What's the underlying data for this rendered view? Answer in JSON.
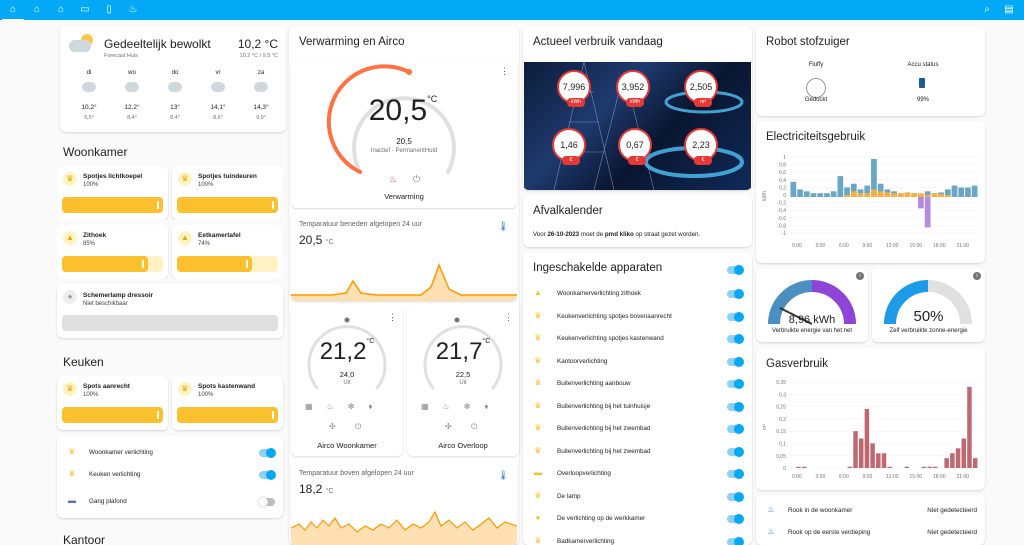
{
  "topbar": {
    "tabs": [
      "home-icon",
      "home-icon",
      "home-icon",
      "monitor-icon",
      "phone-icon",
      "fire-icon"
    ],
    "right": [
      "search-icon",
      "chat-icon"
    ]
  },
  "weather": {
    "condition": "Gedeeltelijk bewolkt",
    "location": "Forecast Huis",
    "temperature": "10,2 °C",
    "subtemp": "10,2 °C / 9,5 °C",
    "days": [
      {
        "day": "di",
        "high": "10,2°",
        "low": "9,5°"
      },
      {
        "day": "wo",
        "high": "12,2°",
        "low": "8,4°"
      },
      {
        "day": "do",
        "high": "13°",
        "low": "8,4°"
      },
      {
        "day": "vr",
        "high": "14,1°",
        "low": "8,6°"
      },
      {
        "day": "za",
        "high": "14,3°",
        "low": "9,9°"
      }
    ]
  },
  "woonkamer": {
    "title": "Woonkamer",
    "tiles": [
      {
        "name": "Spotjes lichtkoepel",
        "state": "100%",
        "level": 1.0
      },
      {
        "name": "Spotjes tuindeuren",
        "state": "100%",
        "level": 1.0
      },
      {
        "name": "Zithoek",
        "state": "85%",
        "level": 0.85
      },
      {
        "name": "Eetkamertafel",
        "state": "74%",
        "level": 0.74
      }
    ],
    "lamp": {
      "name": "Schemerlamp dressoir",
      "state": "Niet beschikbaar"
    }
  },
  "keuken": {
    "title": "Keuken",
    "tiles": [
      {
        "name": "Spots aanrecht",
        "state": "100%",
        "level": 1.0
      },
      {
        "name": "Spots kastenwand",
        "state": "100%",
        "level": 1.0
      }
    ],
    "switches": [
      {
        "label": "Woonkamer verlichting",
        "on": true
      },
      {
        "label": "Keuken verlichting",
        "on": true
      },
      {
        "label": "Gang plafond",
        "on": false
      }
    ]
  },
  "kantoor": {
    "title": "Kantoor"
  },
  "heating": {
    "title": "Verwarming en Airco",
    "main": {
      "temp": "20,5",
      "unit": "°C",
      "target": "20,5",
      "status": "Inactief - PermanentHold",
      "name": "Verwarming"
    },
    "graph1": {
      "title": "Temparatuur beneden afgelopen 24 uur",
      "value": "20,5",
      "unit": "°C"
    },
    "airco1": {
      "temp": "21,2",
      "unit": "°C",
      "target": "24,0",
      "mode": "Uit",
      "name": "Airco Woonkamer"
    },
    "airco2": {
      "temp": "21,7",
      "unit": "°C",
      "target": "22,5",
      "mode": "Uit",
      "name": "Airco Overloop"
    },
    "graph2": {
      "title": "Temparatuur boven afgelopen 24 uur",
      "value": "18,2",
      "unit": "°C"
    }
  },
  "usage": {
    "title": "Actueel verbruik vandaag",
    "bubbles": [
      {
        "value": "7,996",
        "unit": "kWh"
      },
      {
        "value": "3,952",
        "unit": "kWh"
      },
      {
        "value": "2,505",
        "unit": "m³"
      },
      {
        "value": "1,46",
        "unit": "€"
      },
      {
        "value": "0,67",
        "unit": "€"
      },
      {
        "value": "2,23",
        "unit": "€"
      }
    ]
  },
  "afval": {
    "title": "Afvalkalender",
    "prefix": "Voor ",
    "date": "26-10-2023",
    "mid": " moet de ",
    "item": "pmd kliko",
    "suffix": " op straat gezet worden."
  },
  "devices": {
    "title": "Ingeschakelde apparaten",
    "items": [
      "Woonkamerverlichting zithoek",
      "Keukenverlichting spotjes bovenaanrecht",
      "Keukenverlichting spotjes kastenwand",
      "Kantoorverlichting",
      "Buitenverlichting aanbouw",
      "Buitenverlichting bij het tuinhuisje",
      "Buitenverlichting bij het zwembad",
      "Buitenverlichting bij het zwembad",
      "Overloopverlichting",
      "De lamp",
      "De verlichting op de werkkamer",
      "Badkamerverlichting"
    ]
  },
  "robot": {
    "title": "Robot stofzuiger",
    "name": "Fluffy",
    "name_state": "Gedockt",
    "battery_label": "Accu status",
    "battery": "99%"
  },
  "electricity": {
    "title": "Electriciteitsgebruik",
    "ylabel": "kWh",
    "yticks": [
      "1",
      "0,8",
      "0,6",
      "0,4",
      "0,2",
      "0",
      "-0,2",
      "-0,4",
      "-0,6",
      "-0,8",
      "-1"
    ],
    "xticks": [
      "0:00",
      "3:00",
      "6:00",
      "9:00",
      "12:00",
      "15:00",
      "18:00",
      "21:00"
    ]
  },
  "gauges": {
    "energy": {
      "value": "8,96 kWh",
      "label": "Verbruikte energie van het net",
      "fraction": 0.55
    },
    "solar": {
      "value": "50%",
      "label": "Zelf verbruikte zonne-energie",
      "fraction": 0.5
    }
  },
  "gas": {
    "title": "Gasverbruik",
    "ylabel": "m³",
    "yticks": [
      "0,35",
      "0,3",
      "0,25",
      "0,2",
      "0,15",
      "0,1",
      "0,05",
      "0"
    ],
    "xticks": [
      "0:00",
      "3:00",
      "6:00",
      "9:00",
      "12:00",
      "15:00",
      "18:00",
      "21:00"
    ]
  },
  "smoke": {
    "items": [
      {
        "label": "Rook in de woonkamer",
        "state": "Niet gedetecteerd"
      },
      {
        "label": "Rook op de eerste verdieping",
        "state": "Niet gedetecteerd"
      }
    ]
  },
  "colors": {
    "accent": "#03a9f4",
    "amber": "#fbc02d",
    "orange": "#ff9800",
    "red": "#e53935",
    "gas": "#c0686f",
    "elec_blue": "#6aa6c8",
    "elec_orange": "#f5b041",
    "elec_purple": "#b38be0"
  }
}
